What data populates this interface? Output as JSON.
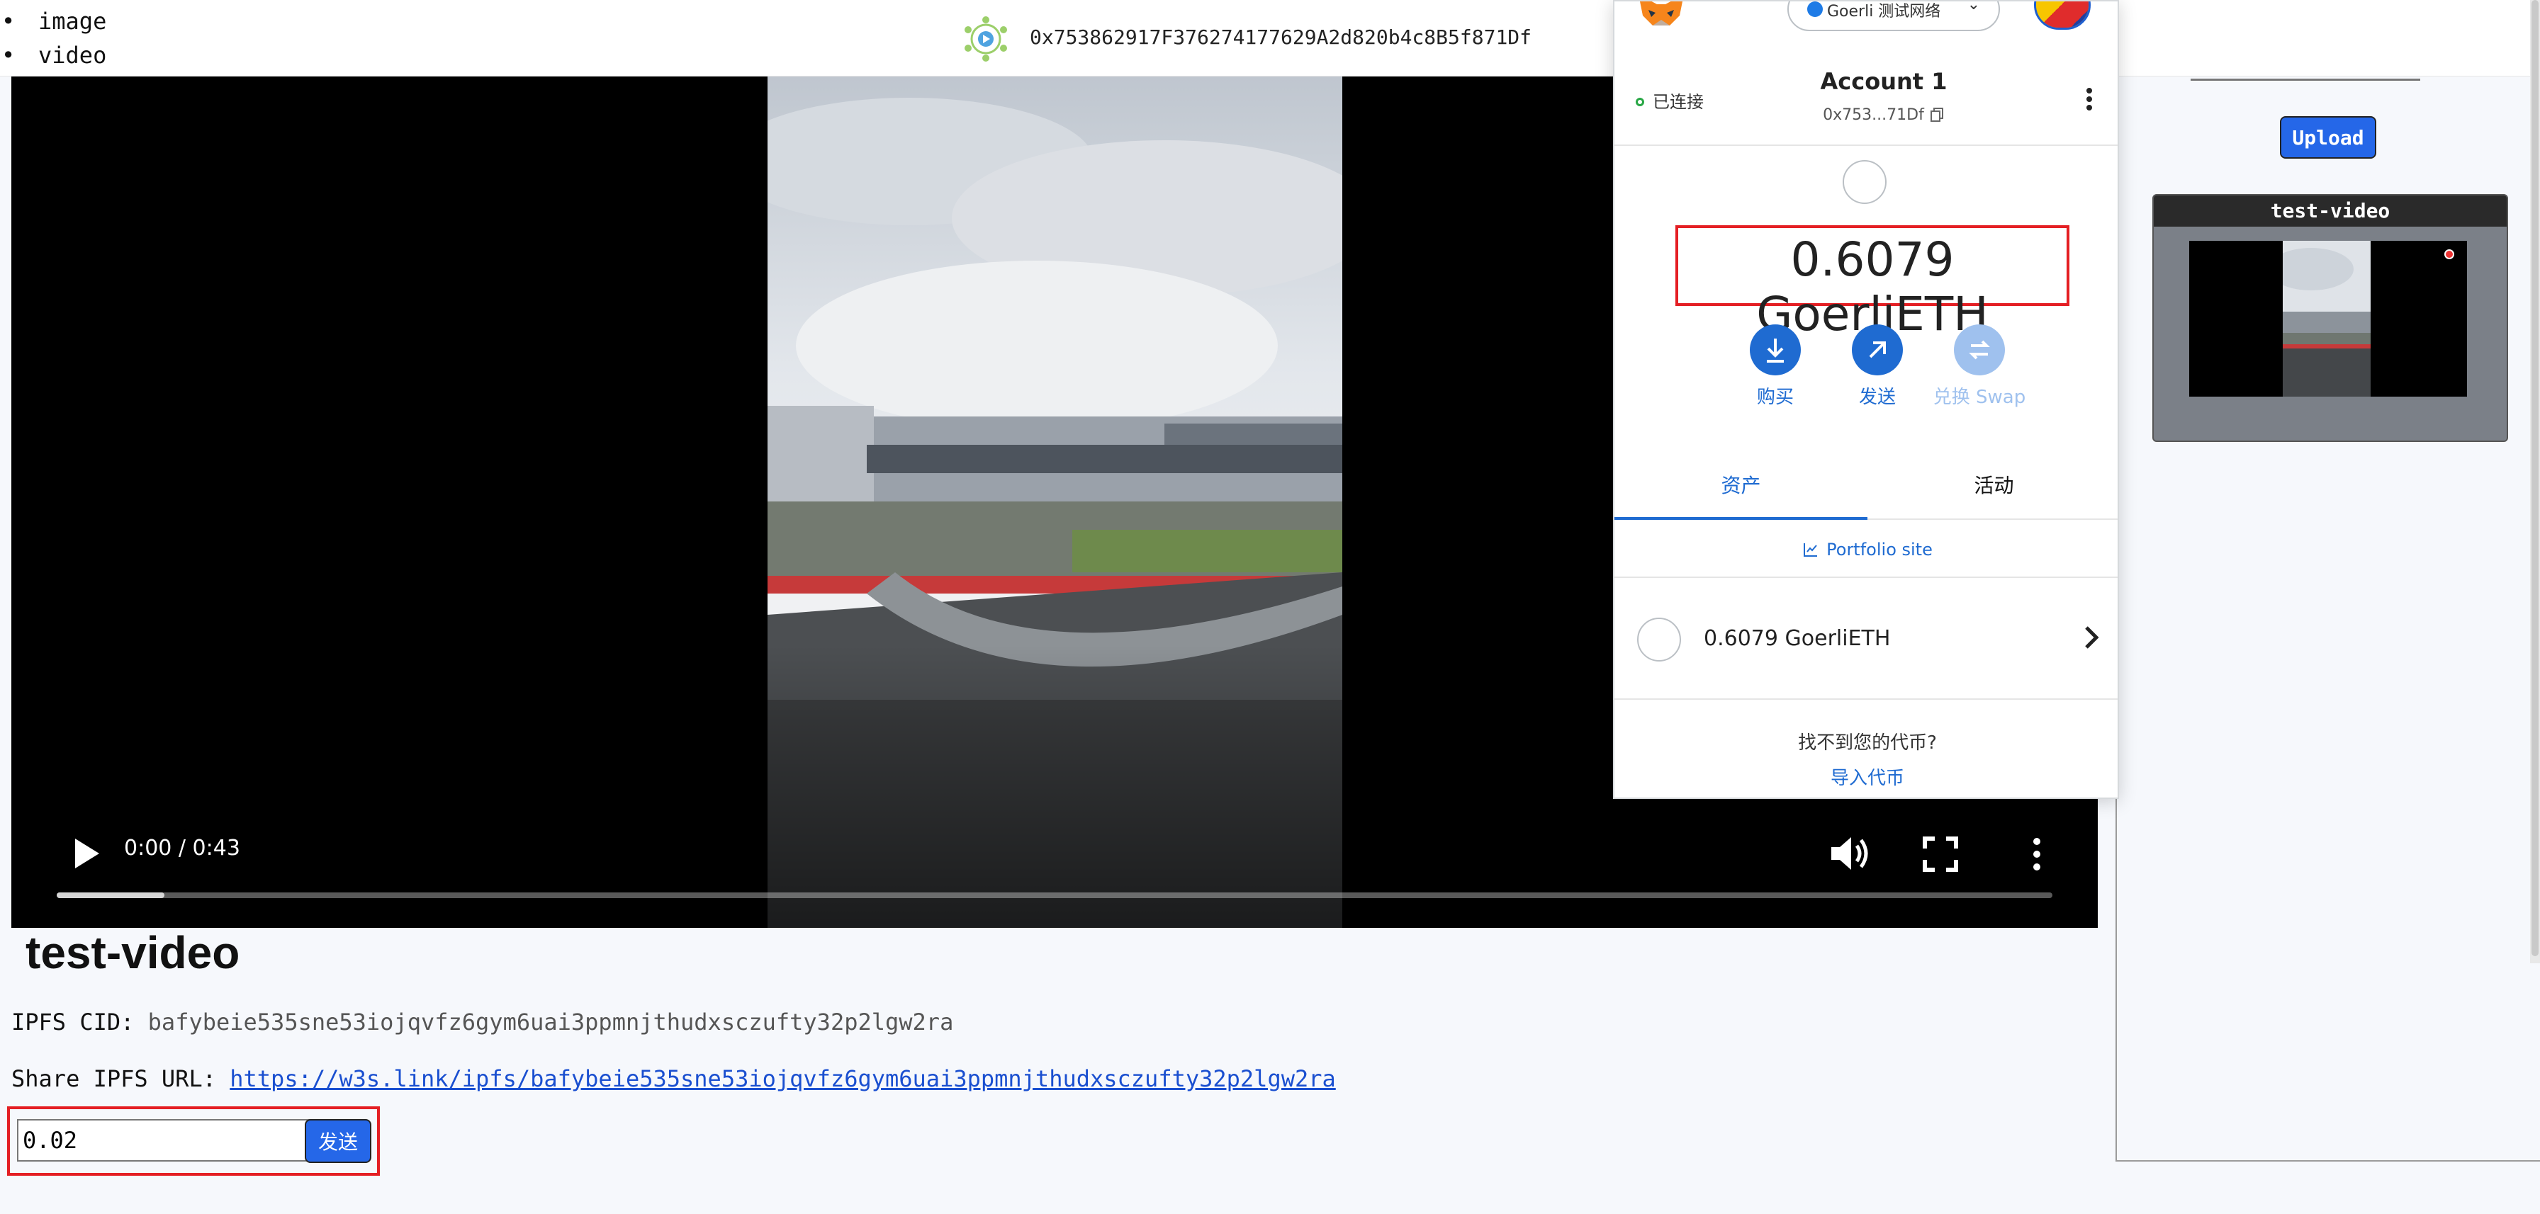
{
  "header": {
    "list_items": [
      "image",
      "video"
    ],
    "wallet_address": "0x753862917F376274177629A2d820b4c8B5f871Df"
  },
  "video_player": {
    "time_display": "0:00 / 0:43",
    "progress_played": 0.054
  },
  "video_info": {
    "title": "test-video",
    "cid_label": "IPFS CID:",
    "cid_value": "bafybeie535sne53iojqvfz6gym6uai3ppmnjthudxsczufty32p2lgw2ra",
    "share_label": "Share IPFS URL:",
    "share_url": "https://w3s.link/ipfs/bafybeie535sne53iojqvfz6gym6uai3ppmnjthudxsczufty32p2lgw2ra"
  },
  "send_form": {
    "amount_value": "0.02",
    "send_label": "发送"
  },
  "sidebar": {
    "upload_label": "Upload",
    "video_cards": [
      {
        "title": "test-video"
      }
    ]
  },
  "wallet": {
    "network_label": "Goerli 测试网络",
    "status": "已连接",
    "account_name": "Account 1",
    "account_address_short": "0x753...71Df",
    "balance": "0.6079 GoerliETH",
    "actions": [
      {
        "label": "购买",
        "icon": "download-icon",
        "enabled": true
      },
      {
        "label": "发送",
        "icon": "arrow-up-right-icon",
        "enabled": true
      },
      {
        "label": "兑换 Swap",
        "icon": "swap-icon",
        "enabled": false
      }
    ],
    "tabs": [
      {
        "label": "资产",
        "active": true
      },
      {
        "label": "活动",
        "active": false
      }
    ],
    "portfolio_link": "Portfolio site",
    "asset_row": "0.6079 GoerliETH",
    "missing_token_text": "找不到您的代币?",
    "import_token_link": "导入代币"
  },
  "colors": {
    "accent_blue": "#1f6bd1",
    "button_blue": "#2567e8",
    "highlight_red": "#e41f24",
    "connected_green": "#28a745"
  }
}
